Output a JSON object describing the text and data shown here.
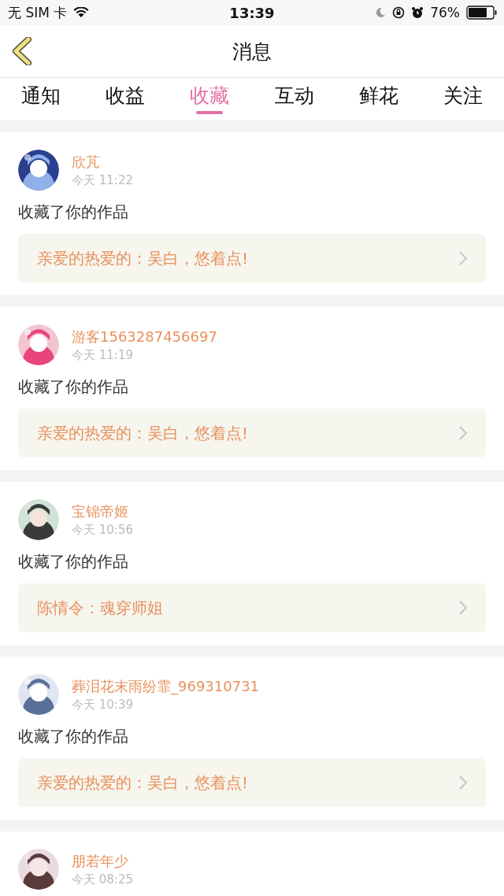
{
  "status_bar": {
    "carrier": "无 SIM 卡",
    "time": "13:39",
    "battery": "76%"
  },
  "header": {
    "title": "消息"
  },
  "tabs": [
    {
      "label": "通知",
      "selected": false
    },
    {
      "label": "收益",
      "selected": false
    },
    {
      "label": "收藏",
      "selected": true
    },
    {
      "label": "互动",
      "selected": false
    },
    {
      "label": "鲜花",
      "selected": false
    },
    {
      "label": "关注",
      "selected": false
    }
  ],
  "messages": [
    {
      "user": "欣芃",
      "time": "今天 11:22",
      "action": "收藏了你的作品",
      "work": "亲爱的热爱的：吴白，悠着点!"
    },
    {
      "user": "游客1563287456697",
      "time": "今天 11:19",
      "action": "收藏了你的作品",
      "work": "亲爱的热爱的：吴白，悠着点!"
    },
    {
      "user": "宝锦帝姬",
      "time": "今天 10:56",
      "action": "收藏了你的作品",
      "work": "陈情令：魂穿师姐"
    },
    {
      "user": "葬泪花末雨纷霏_969310731",
      "time": "今天 10:39",
      "action": "收藏了你的作品",
      "work": "亲爱的热爱的：吴白，悠着点!"
    },
    {
      "user": "朋若年少",
      "time": "今天 08:25"
    }
  ]
}
